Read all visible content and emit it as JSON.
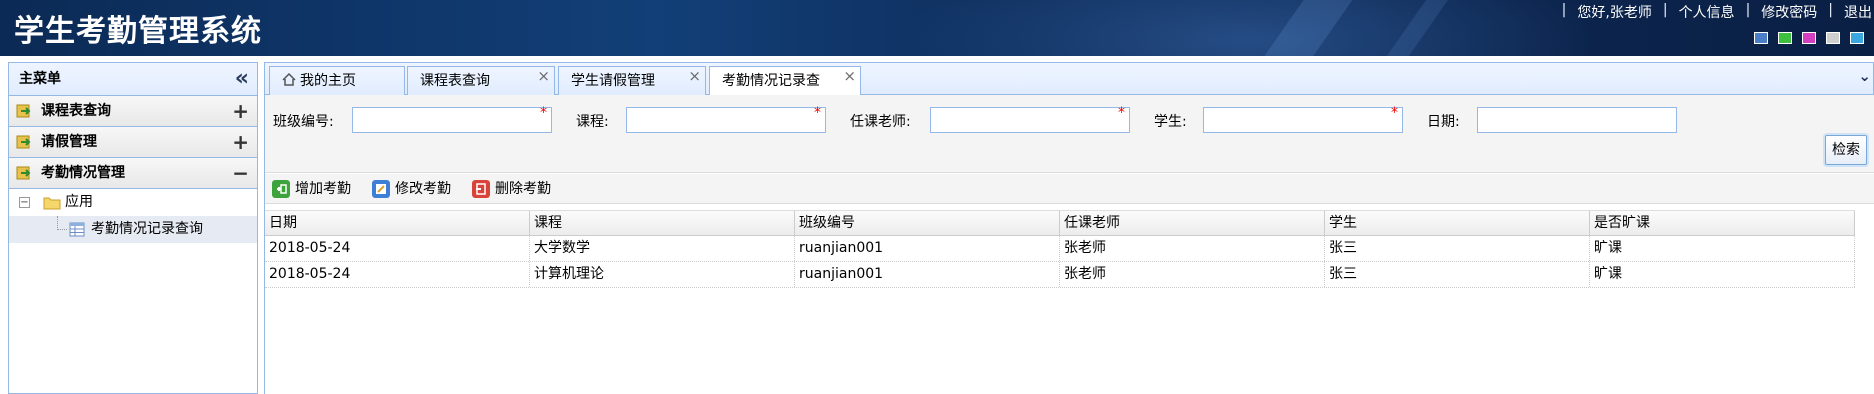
{
  "app": {
    "title": "学生考勤管理系统",
    "greeting": "您好,张老师",
    "links": [
      "个人信息",
      "修改密码",
      "退出"
    ],
    "theme_colors": [
      "#4a7fc8",
      "#3fbf3f",
      "#d33fbf",
      "#cfcfcf",
      "#3aa7e0"
    ]
  },
  "sidebar": {
    "title": "主菜单",
    "items": [
      {
        "label": "课程表查询",
        "state": "+"
      },
      {
        "label": "请假管理",
        "state": "+"
      },
      {
        "label": "考勤情况管理",
        "state": "−"
      }
    ],
    "tree": {
      "folder": "应用",
      "leaf": "考勤情况记录查询"
    }
  },
  "tabs": [
    {
      "label": "我的主页",
      "closable": false
    },
    {
      "label": "课程表查询",
      "closable": true
    },
    {
      "label": "学生请假管理",
      "closable": true
    },
    {
      "label": "考勤情况记录查",
      "closable": true,
      "active": true
    }
  ],
  "search": {
    "fields": [
      {
        "label": "班级编号:",
        "value": "",
        "required": true
      },
      {
        "label": "课程:",
        "value": "",
        "required": true
      },
      {
        "label": "任课老师:",
        "value": "",
        "required": true
      },
      {
        "label": "学生:",
        "value": "",
        "required": true
      },
      {
        "label": "日期:",
        "value": "",
        "required": false
      }
    ],
    "button": "检索"
  },
  "toolbar": {
    "add": "增加考勤",
    "edit": "修改考勤",
    "delete": "删除考勤"
  },
  "table": {
    "columns": [
      "日期",
      "课程",
      "班级编号",
      "任课老师",
      "学生",
      "是否旷课"
    ],
    "rows": [
      [
        "2018-05-24",
        "大学数学",
        "ruanjian001",
        "张老师",
        "张三",
        "旷课"
      ],
      [
        "2018-05-24",
        "计算机理论",
        "ruanjian001",
        "张老师",
        "张三",
        "旷课"
      ]
    ]
  }
}
